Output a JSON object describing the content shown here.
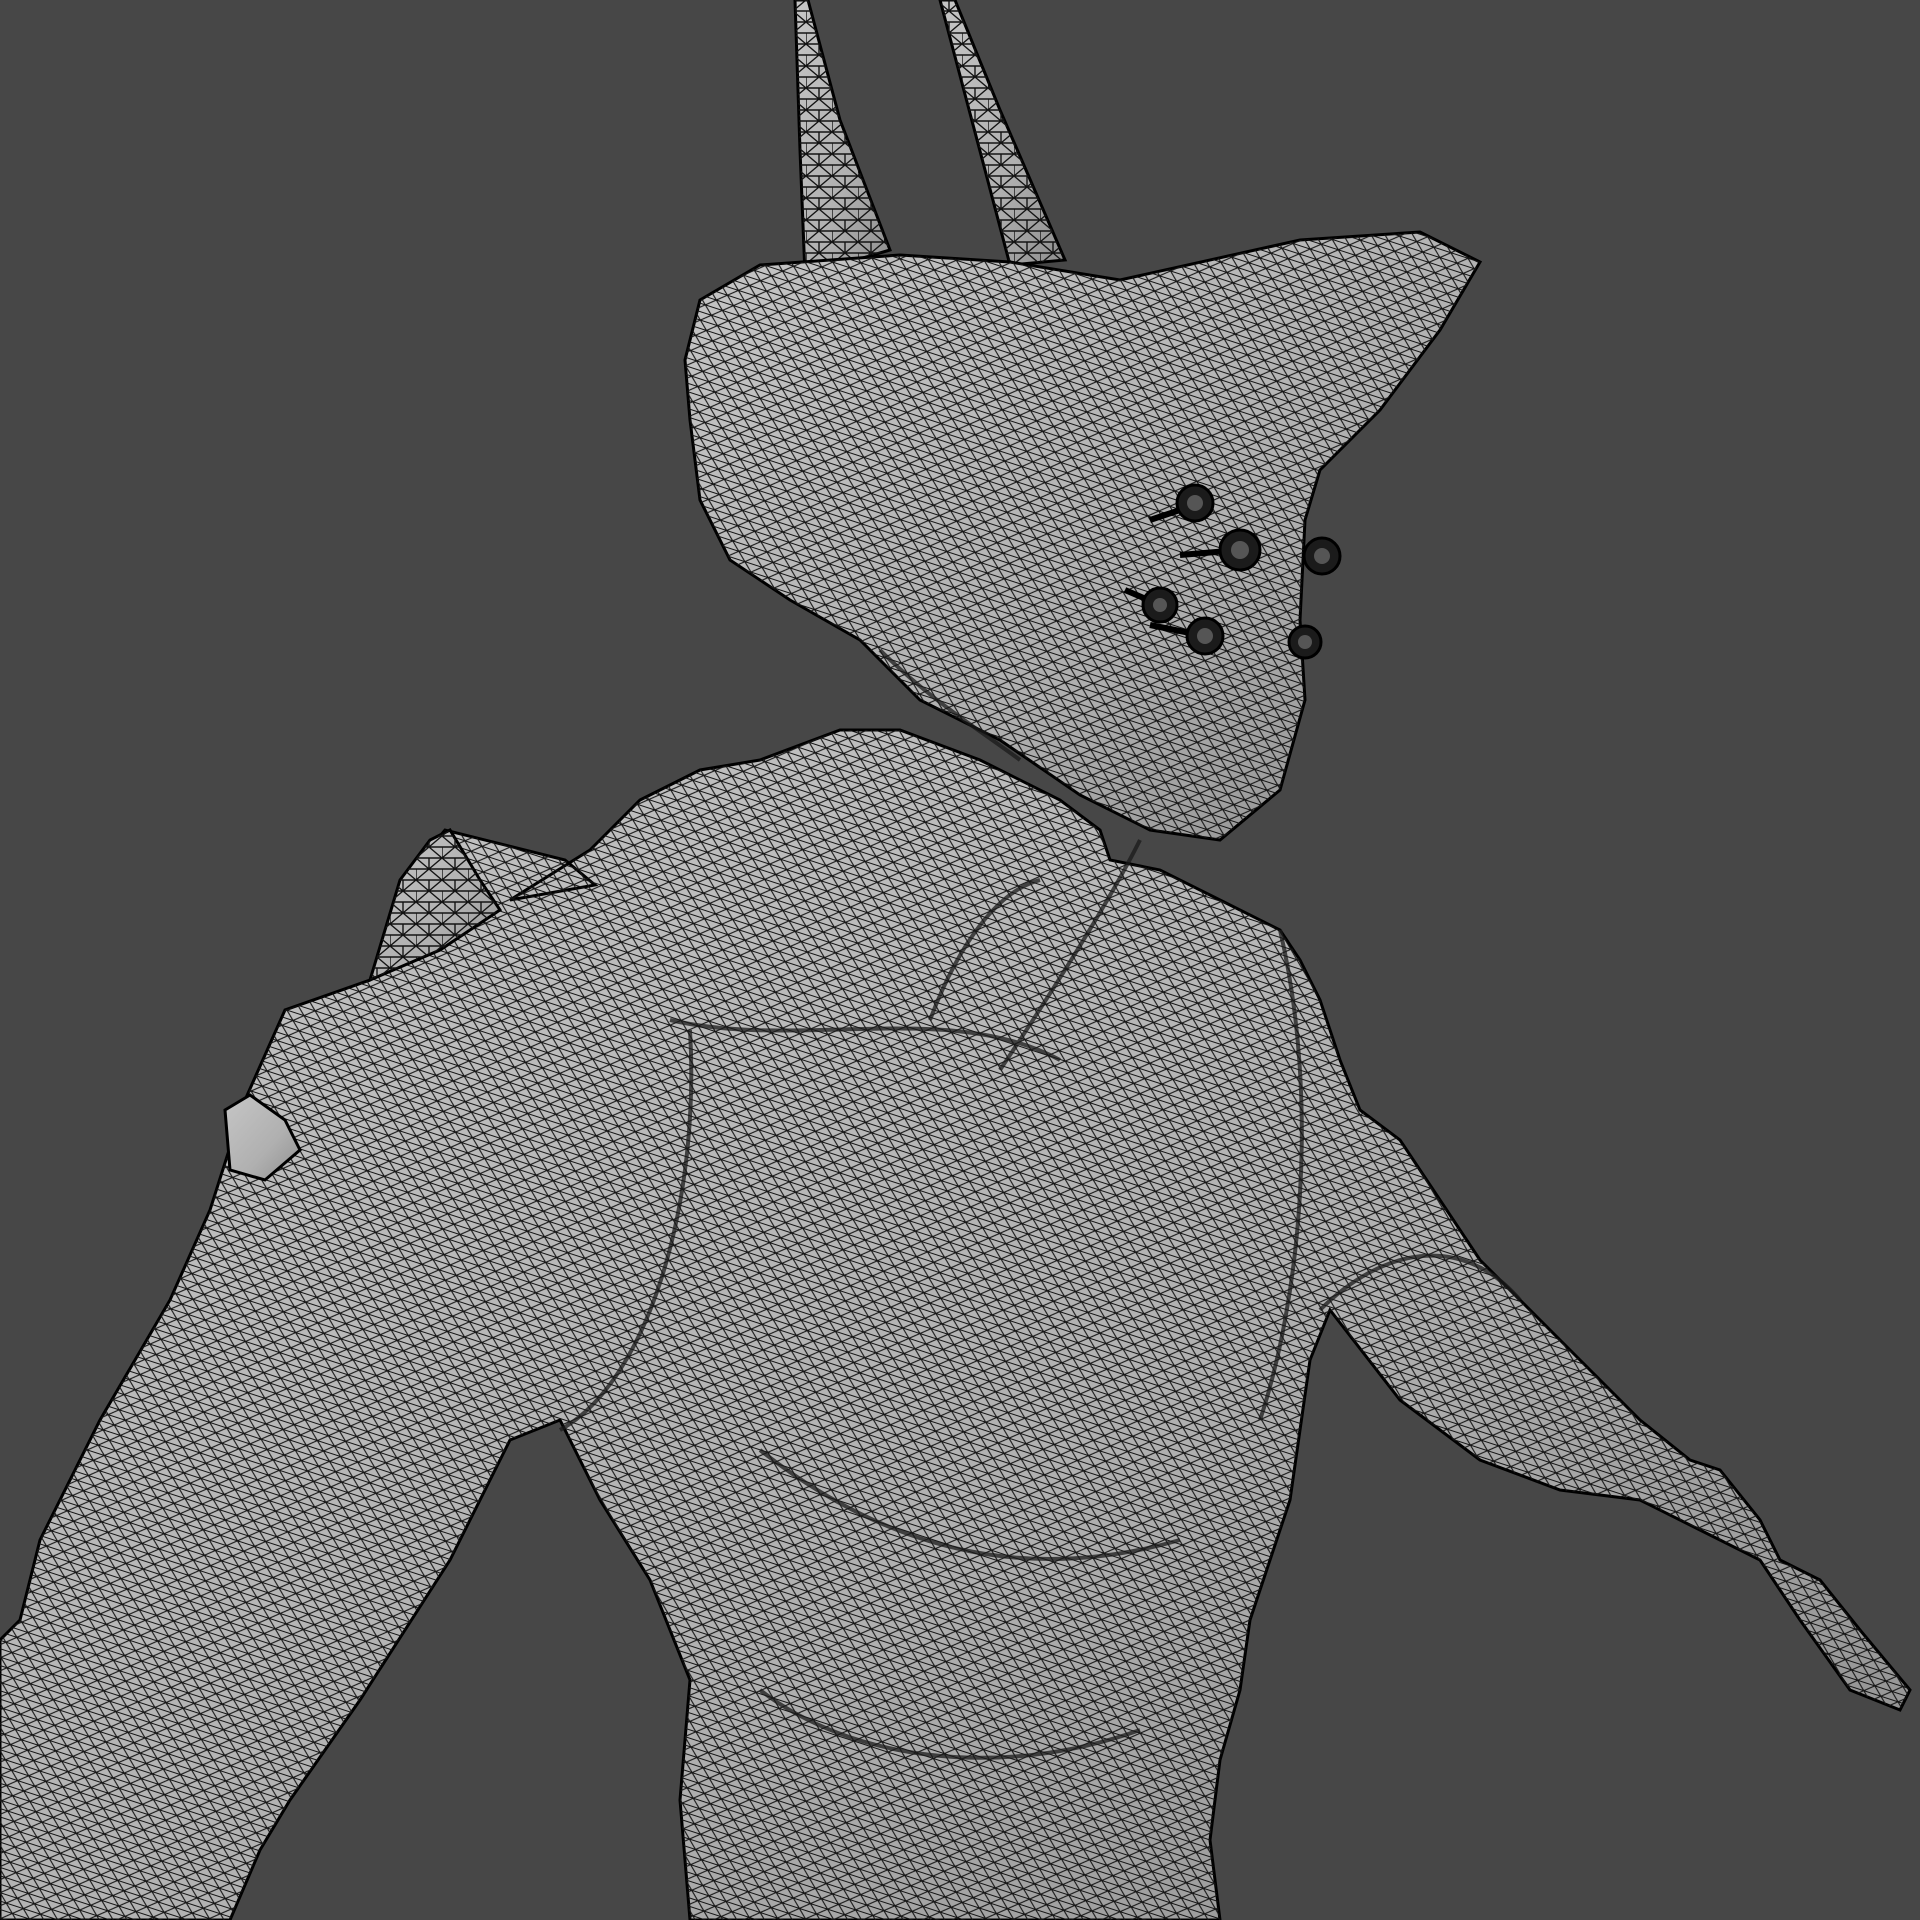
{
  "scene": {
    "background_color": "#474747",
    "mesh_fill_color": "#b8b8b8",
    "mesh_shadow_color": "#8c8c8c",
    "wire_color": "#141414",
    "subject": "wireframe-creature-mesh",
    "render_style": "wireframe-over-solid",
    "eye_count": 6
  }
}
